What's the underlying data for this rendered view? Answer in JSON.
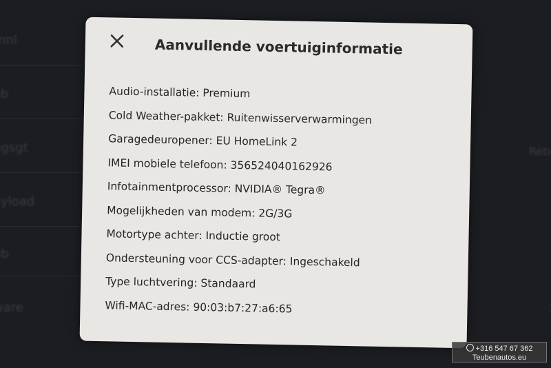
{
  "modal": {
    "title": "Aanvullende voertuiginformatie",
    "close_icon": "close-icon",
    "items": [
      {
        "label": "Audio-installatie",
        "value": "Premium"
      },
      {
        "label": "Cold Weather-pakket",
        "value": "Ruitenwisserverwarmingen"
      },
      {
        "label": "Garagedeuropener",
        "value": "EU HomeLink 2"
      },
      {
        "label": "IMEI mobiele telefoon",
        "value": "356524040162926"
      },
      {
        "label": "Infotainmentprocessor",
        "value": "NVIDIA® Tegra®"
      },
      {
        "label": "Mogelijkheden van modem",
        "value": "2G/3G"
      },
      {
        "label": "Motortype achter",
        "value": "Inductie groot"
      },
      {
        "label": "Ondersteuning voor CCS-adapter",
        "value": "Ingeschakeld"
      },
      {
        "label": "Type luchtvering",
        "value": "Standaard"
      },
      {
        "label": "Wifi-MAC-adres",
        "value": "90:03:b7:27:a6:65"
      }
    ]
  },
  "watermark": {
    "phone": "+316 547 67 362",
    "site": "Teubenautos.eu",
    "icon": "whatsapp-icon"
  },
  "colors": {
    "background": "#1c1d22",
    "modal": "#e9e7e3",
    "text": "#262626"
  }
}
